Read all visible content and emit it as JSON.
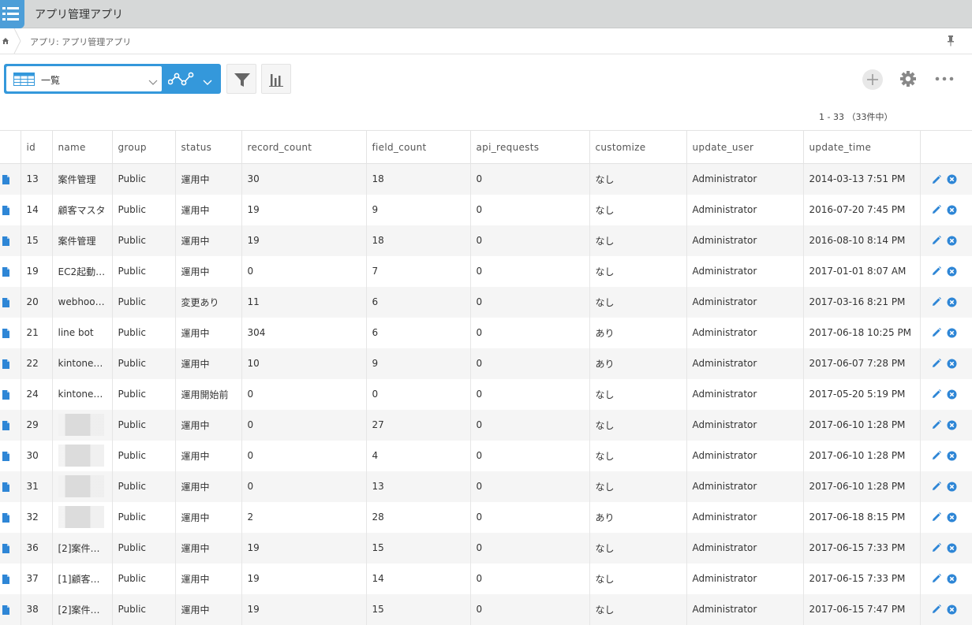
{
  "app": {
    "title": "アプリ管理アプリ"
  },
  "breadcrumb": {
    "path": "アプリ: アプリ管理アプリ"
  },
  "toolbar": {
    "view_name": "一覧"
  },
  "pager": {
    "text": "1 - 33 （33件中）"
  },
  "table": {
    "columns": [
      "id",
      "name",
      "group",
      "status",
      "record_count",
      "field_count",
      "api_requests",
      "customize",
      "update_user",
      "update_time"
    ],
    "rows": [
      {
        "id": "13",
        "name": "案件管理",
        "group": "Public",
        "status": "運用中",
        "record_count": "30",
        "field_count": "18",
        "api_requests": "0",
        "customize": "なし",
        "update_user": "Administrator",
        "update_time": "2014-03-13 7:51 PM",
        "blurred": false
      },
      {
        "id": "14",
        "name": "顧客マスタ",
        "group": "Public",
        "status": "運用中",
        "record_count": "19",
        "field_count": "9",
        "api_requests": "0",
        "customize": "なし",
        "update_user": "Administrator",
        "update_time": "2016-07-20 7:45 PM",
        "blurred": false
      },
      {
        "id": "15",
        "name": "案件管理",
        "group": "Public",
        "status": "運用中",
        "record_count": "19",
        "field_count": "18",
        "api_requests": "0",
        "customize": "なし",
        "update_user": "Administrator",
        "update_time": "2016-08-10 8:14 PM",
        "blurred": false
      },
      {
        "id": "19",
        "name": "EC2起動…",
        "group": "Public",
        "status": "運用中",
        "record_count": "0",
        "field_count": "7",
        "api_requests": "0",
        "customize": "なし",
        "update_user": "Administrator",
        "update_time": "2017-01-01 8:07 AM",
        "blurred": false
      },
      {
        "id": "20",
        "name": "webhoo…",
        "group": "Public",
        "status": "変更あり",
        "record_count": "11",
        "field_count": "6",
        "api_requests": "0",
        "customize": "なし",
        "update_user": "Administrator",
        "update_time": "2017-03-16 8:21 PM",
        "blurred": false
      },
      {
        "id": "21",
        "name": "line bot",
        "group": "Public",
        "status": "運用中",
        "record_count": "304",
        "field_count": "6",
        "api_requests": "0",
        "customize": "あり",
        "update_user": "Administrator",
        "update_time": "2017-06-18 10:25 PM",
        "blurred": false
      },
      {
        "id": "22",
        "name": "kintone…",
        "group": "Public",
        "status": "運用中",
        "record_count": "10",
        "field_count": "9",
        "api_requests": "0",
        "customize": "あり",
        "update_user": "Administrator",
        "update_time": "2017-06-07 7:28 PM",
        "blurred": false
      },
      {
        "id": "24",
        "name": "kintone…",
        "group": "Public",
        "status": "運用開始前",
        "record_count": "0",
        "field_count": "0",
        "api_requests": "0",
        "customize": "なし",
        "update_user": "Administrator",
        "update_time": "2017-05-20 5:19 PM",
        "blurred": false
      },
      {
        "id": "29",
        "name": "",
        "group": "Public",
        "status": "運用中",
        "record_count": "0",
        "field_count": "27",
        "api_requests": "0",
        "customize": "なし",
        "update_user": "Administrator",
        "update_time": "2017-06-10 1:28 PM",
        "blurred": true
      },
      {
        "id": "30",
        "name": "",
        "group": "Public",
        "status": "運用中",
        "record_count": "0",
        "field_count": "4",
        "api_requests": "0",
        "customize": "なし",
        "update_user": "Administrator",
        "update_time": "2017-06-10 1:28 PM",
        "blurred": true
      },
      {
        "id": "31",
        "name": "",
        "group": "Public",
        "status": "運用中",
        "record_count": "0",
        "field_count": "13",
        "api_requests": "0",
        "customize": "なし",
        "update_user": "Administrator",
        "update_time": "2017-06-10 1:28 PM",
        "blurred": true
      },
      {
        "id": "32",
        "name": "",
        "group": "Public",
        "status": "運用中",
        "record_count": "2",
        "field_count": "28",
        "api_requests": "0",
        "customize": "あり",
        "update_user": "Administrator",
        "update_time": "2017-06-18 8:15 PM",
        "blurred": true
      },
      {
        "id": "36",
        "name": "[2]案件…",
        "group": "Public",
        "status": "運用中",
        "record_count": "19",
        "field_count": "15",
        "api_requests": "0",
        "customize": "なし",
        "update_user": "Administrator",
        "update_time": "2017-06-15 7:33 PM",
        "blurred": false
      },
      {
        "id": "37",
        "name": "[1]顧客…",
        "group": "Public",
        "status": "運用中",
        "record_count": "19",
        "field_count": "14",
        "api_requests": "0",
        "customize": "なし",
        "update_user": "Administrator",
        "update_time": "2017-06-15 7:33 PM",
        "blurred": false
      },
      {
        "id": "38",
        "name": "[2]案件…",
        "group": "Public",
        "status": "運用中",
        "record_count": "19",
        "field_count": "15",
        "api_requests": "0",
        "customize": "なし",
        "update_user": "Administrator",
        "update_time": "2017-06-15 7:47 PM",
        "blurred": false
      }
    ]
  },
  "colors": {
    "accent": "#3498db",
    "header_bg": "#d6d8d8",
    "row_alt": "#f5f5f5",
    "icon_blue": "#2e86d6"
  },
  "icons": [
    "app-list-icon",
    "home-icon",
    "pin-icon",
    "table-view-icon",
    "chevron-down-icon",
    "graph-icon",
    "filter-icon",
    "chart-icon",
    "plus-icon",
    "gear-icon",
    "more-icon",
    "document-icon",
    "edit-icon",
    "delete-icon"
  ]
}
